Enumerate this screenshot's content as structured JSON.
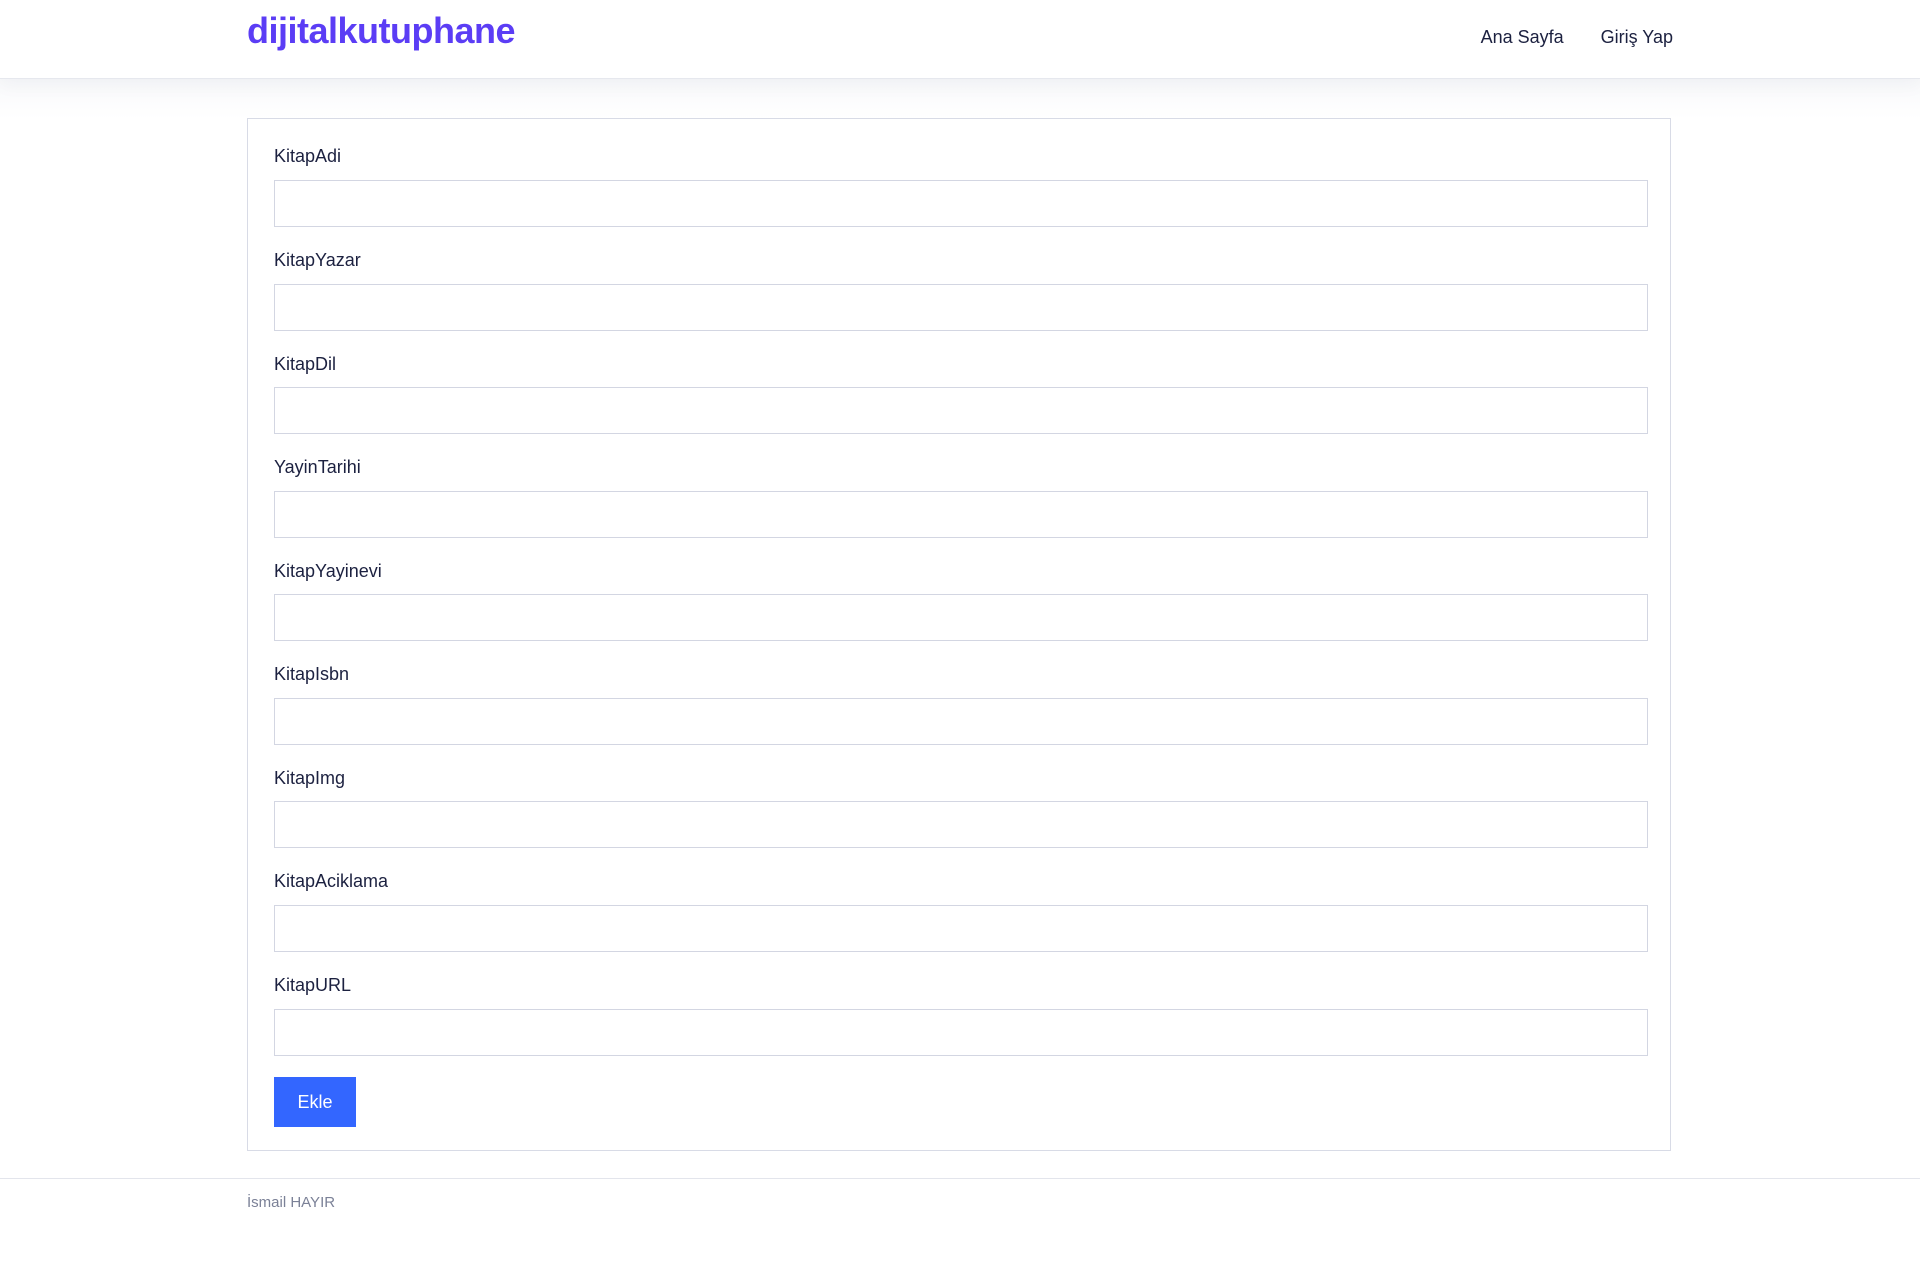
{
  "colors": {
    "brand": "#5b3df5",
    "button": "#3366ff"
  },
  "header": {
    "brand": "dijitalkutuphane",
    "nav": [
      {
        "label": "Ana Sayfa"
      },
      {
        "label": "Giriş Yap"
      }
    ]
  },
  "form": {
    "fields": [
      {
        "label": "KitapAdi",
        "value": ""
      },
      {
        "label": "KitapYazar",
        "value": ""
      },
      {
        "label": "KitapDil",
        "value": ""
      },
      {
        "label": "YayinTarihi",
        "value": ""
      },
      {
        "label": "KitapYayinevi",
        "value": ""
      },
      {
        "label": "KitapIsbn",
        "value": ""
      },
      {
        "label": "KitapImg",
        "value": ""
      },
      {
        "label": "KitapAciklama",
        "value": ""
      },
      {
        "label": "KitapURL",
        "value": ""
      }
    ],
    "submit_label": "Ekle"
  },
  "footer": {
    "text": "İsmail HAYIR"
  }
}
